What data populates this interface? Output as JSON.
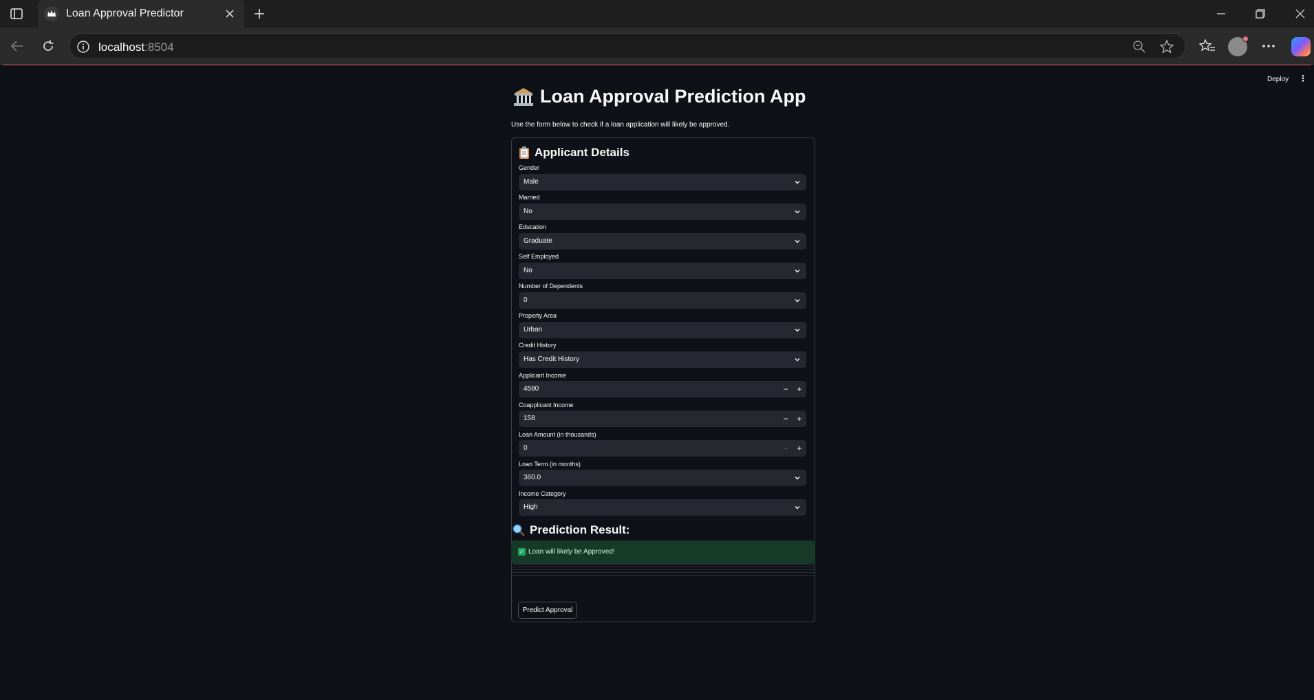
{
  "browser": {
    "tab_title": "Loan Approval Predictor",
    "url_host": "localhost",
    "url_port": ":8504"
  },
  "app": {
    "deploy_label": "Deploy",
    "title": "Loan Approval Prediction App",
    "subtitle": "Use the form below to check if a loan application will likely be approved.",
    "form_title": "Applicant Details",
    "fields": {
      "gender": {
        "label": "Gender",
        "value": "Male"
      },
      "married": {
        "label": "Married",
        "value": "No"
      },
      "education": {
        "label": "Education",
        "value": "Graduate"
      },
      "self_employed": {
        "label": "Self Employed",
        "value": "No"
      },
      "dependents": {
        "label": "Number of Dependents",
        "value": "0"
      },
      "property_area": {
        "label": "Property Area",
        "value": "Urban"
      },
      "credit_history": {
        "label": "Credit History",
        "value": "Has Credit History"
      },
      "applicant_income": {
        "label": "Applicant Income",
        "value": "4580"
      },
      "coapplicant_income": {
        "label": "Coapplicant Income",
        "value": "158"
      },
      "loan_amount": {
        "label": "Loan Amount (in thousands)",
        "value": "0"
      },
      "loan_term": {
        "label": "Loan Term (in months)",
        "value": "360.0"
      },
      "income_category": {
        "label": "Income Category",
        "value": "High"
      }
    },
    "submit_label": "Predict Approval",
    "result_title": "Prediction Result:",
    "result_message": "Loan will likely be Approved!"
  },
  "colors": {
    "background": "#0e1117",
    "input_bg": "#262730",
    "success_bg": "#173928",
    "accent_line": "#e0485a"
  },
  "icons": [
    "sidebar-toggle-icon",
    "crown-icon",
    "close-icon",
    "plus-icon",
    "minimize-icon",
    "restore-icon",
    "back-arrow-icon",
    "reload-icon",
    "info-icon",
    "zoom-out-icon",
    "star-icon",
    "favorites-icon",
    "profile-icon",
    "more-icon",
    "copilot-icon",
    "bank-icon",
    "clipboard-icon",
    "magnifier-icon",
    "check-icon",
    "chevron-down-icon"
  ]
}
